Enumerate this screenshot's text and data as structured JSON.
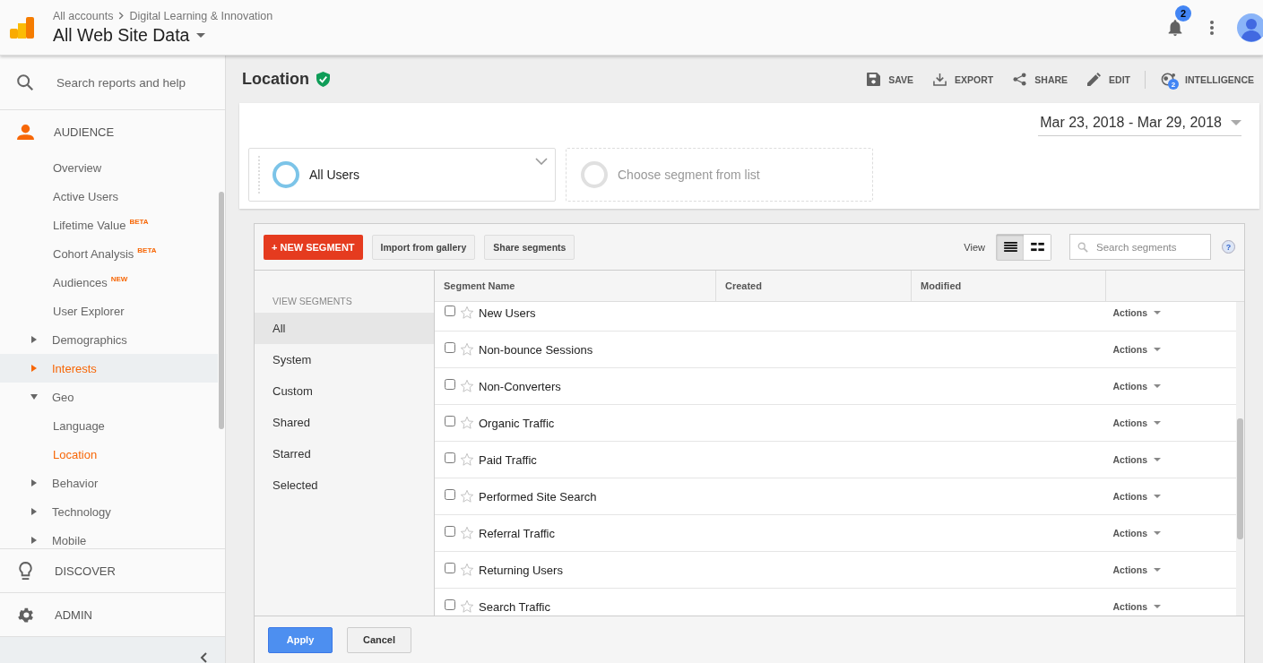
{
  "header": {
    "breadcrumb": [
      "All accounts",
      "Digital Learning & Innovation"
    ],
    "view_title": "All Web Site Data",
    "notification_count": "2"
  },
  "sidebar": {
    "search": {
      "placeholder": "Search reports and help"
    },
    "audience": {
      "label": "AUDIENCE",
      "items": [
        {
          "label": "Overview",
          "selected": false,
          "hovered": false
        },
        {
          "label": "Active Users",
          "selected": false,
          "hovered": false
        },
        {
          "label": "Lifetime Value",
          "badge": "BETA",
          "selected": false,
          "hovered": false
        },
        {
          "label": "Cohort Analysis",
          "badge": "BETA",
          "selected": false,
          "hovered": false
        },
        {
          "label": "Audiences",
          "badge": "NEW",
          "selected": false,
          "hovered": false
        },
        {
          "label": "User Explorer",
          "selected": false,
          "hovered": false
        },
        {
          "label": "Demographics",
          "expanded": false,
          "selected": false,
          "hovered": false
        },
        {
          "label": "Interests",
          "expanded": false,
          "selected": true,
          "hovered": true
        },
        {
          "label": "Geo",
          "expanded": true,
          "selected": false,
          "hovered": false,
          "children": [
            {
              "label": "Language",
              "selected": false,
              "hovered": false
            },
            {
              "label": "Location",
              "selected": true,
              "hovered": false
            }
          ]
        },
        {
          "label": "Behavior",
          "expanded": false,
          "selected": false,
          "hovered": false
        },
        {
          "label": "Technology",
          "expanded": false,
          "selected": false,
          "hovered": false
        },
        {
          "label": "Mobile",
          "expanded": false,
          "selected": false,
          "hovered": false
        }
      ]
    },
    "sections": [
      {
        "label": "DISCOVER",
        "kind": "discover"
      },
      {
        "label": "ADMIN",
        "kind": "admin"
      }
    ]
  },
  "report": {
    "title": "Location",
    "actions": [
      {
        "label": "SAVE",
        "kind": "save"
      },
      {
        "label": "EXPORT",
        "kind": "export"
      },
      {
        "label": "SHARE",
        "kind": "share"
      },
      {
        "label": "EDIT",
        "kind": "edit"
      },
      {
        "label": "INTELLIGENCE",
        "kind": "intelligence",
        "badge": "2"
      }
    ],
    "date_range": "Mar 23, 2018 - Mar 29, 2018",
    "segments": [
      {
        "label": "All Users",
        "kind": "active"
      },
      {
        "label": "Choose segment from list",
        "kind": "empty"
      }
    ]
  },
  "segment_panel": {
    "new_button": "+ NEW SEGMENT",
    "buttons": [
      "Import from gallery",
      "Share segments"
    ],
    "view_label": "View",
    "view_modes": [
      {
        "kind": "list",
        "selected": true
      },
      {
        "kind": "grid",
        "selected": false
      }
    ],
    "search": {
      "placeholder": "Search segments"
    },
    "help": "?",
    "filters_heading": "VIEW SEGMENTS",
    "filters": [
      {
        "label": "All",
        "selected": true
      },
      {
        "label": "System",
        "selected": false
      },
      {
        "label": "Custom",
        "selected": false
      },
      {
        "label": "Shared",
        "selected": false
      },
      {
        "label": "Starred",
        "selected": false
      },
      {
        "label": "Selected",
        "selected": false
      }
    ],
    "columns": [
      "Segment Name",
      "Created",
      "Modified"
    ],
    "rows": [
      {
        "name": "New Users",
        "checked": false,
        "starred": false,
        "actions": "Actions"
      },
      {
        "name": "Non-bounce Sessions",
        "checked": false,
        "starred": false,
        "actions": "Actions"
      },
      {
        "name": "Non-Converters",
        "checked": false,
        "starred": false,
        "actions": "Actions"
      },
      {
        "name": "Organic Traffic",
        "checked": false,
        "starred": false,
        "actions": "Actions"
      },
      {
        "name": "Paid Traffic",
        "checked": false,
        "starred": false,
        "actions": "Actions"
      },
      {
        "name": "Performed Site Search",
        "checked": false,
        "starred": false,
        "actions": "Actions"
      },
      {
        "name": "Referral Traffic",
        "checked": false,
        "starred": false,
        "actions": "Actions"
      },
      {
        "name": "Returning Users",
        "checked": false,
        "starred": false,
        "actions": "Actions"
      },
      {
        "name": "Search Traffic",
        "checked": false,
        "starred": false,
        "actions": "Actions"
      }
    ],
    "footer_buttons": [
      {
        "label": "Apply",
        "kind": "primary"
      },
      {
        "label": "Cancel",
        "kind": "secondary"
      }
    ]
  }
}
